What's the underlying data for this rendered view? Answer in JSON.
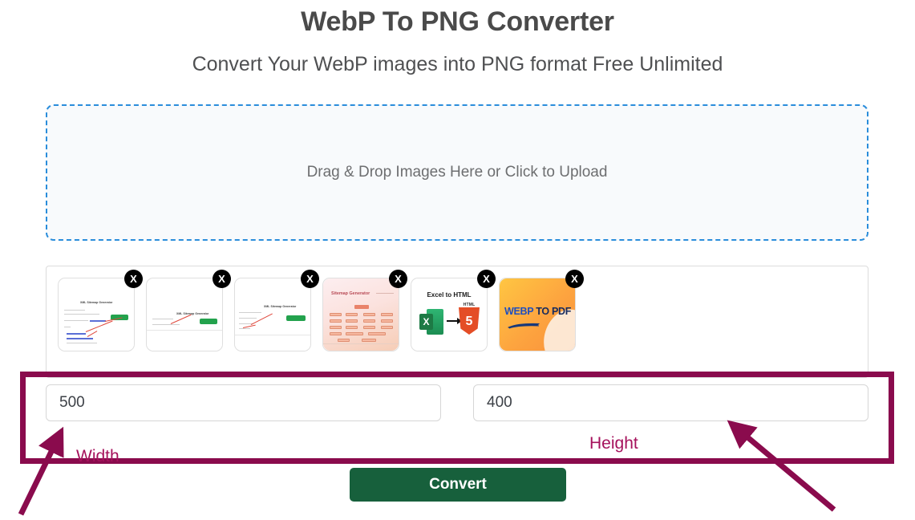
{
  "header": {
    "title": "WebP To PNG Converter",
    "subtitle": "Convert Your WebP images into PNG format Free Unlimited"
  },
  "dropzone": {
    "text": "Drag & Drop Images Here or Click to Upload",
    "border_color": "#2a8ddb",
    "background": "#f8fafc"
  },
  "thumbnails": {
    "remove_label": "X",
    "items": [
      {
        "name": "sitemap-generator-doc-1",
        "kind": "doc",
        "caption": "XML Sitemap Generator"
      },
      {
        "name": "sitemap-generator-doc-2",
        "kind": "doc",
        "caption": "XML Sitemap Generator"
      },
      {
        "name": "sitemap-generator-doc-3",
        "kind": "doc",
        "caption": "XML Sitemap Generator"
      },
      {
        "name": "sitemap-generator-card",
        "kind": "sitemap",
        "caption": "Sitemap Generator"
      },
      {
        "name": "excel-to-html-card",
        "kind": "excel",
        "caption": "Excel to HTML",
        "excel_glyph": "X",
        "html_label": "HTML",
        "html_version": "5"
      },
      {
        "name": "webp-to-pdf-card",
        "kind": "webp",
        "caption_a": "WEBP",
        "caption_b": " TO PDF"
      }
    ]
  },
  "size": {
    "width_value": "500",
    "height_value": "400",
    "width_placeholder": "Width",
    "height_placeholder": "Height"
  },
  "actions": {
    "convert_label": "Convert",
    "convert_color": "#17603c"
  },
  "annotations": {
    "color": "#8a0b4d",
    "text_color": "#a5125c",
    "width_label": "Width",
    "height_label": "Height"
  }
}
